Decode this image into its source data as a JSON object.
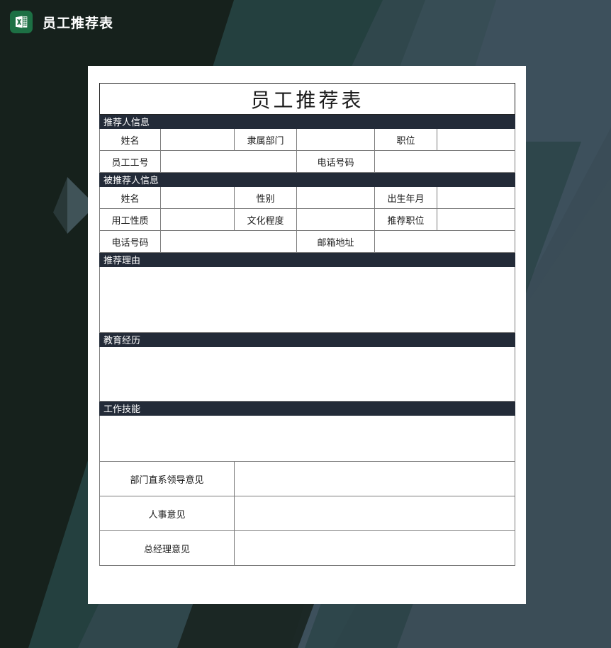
{
  "window": {
    "app_icon": "excel-icon",
    "title": "员工推荐表"
  },
  "document": {
    "title": "员工推荐表",
    "sections": [
      {
        "id": "referrer",
        "band_label": "推荐人信息",
        "rows": [
          {
            "cells": [
              {
                "label": "姓名",
                "value": ""
              },
              {
                "label": "隶属部门",
                "value": ""
              },
              {
                "label": "职位",
                "value": ""
              }
            ]
          },
          {
            "cells": [
              {
                "label": "员工工号",
                "value": ""
              },
              {
                "label": "电话号码",
                "value": ""
              }
            ]
          }
        ]
      },
      {
        "id": "referee",
        "band_label": "被推荐人信息",
        "rows": [
          {
            "cells": [
              {
                "label": "姓名",
                "value": ""
              },
              {
                "label": "性别",
                "value": ""
              },
              {
                "label": "出生年月",
                "value": ""
              }
            ]
          },
          {
            "cells": [
              {
                "label": "用工性质",
                "value": ""
              },
              {
                "label": "文化程度",
                "value": ""
              },
              {
                "label": "推荐职位",
                "value": ""
              }
            ]
          },
          {
            "cells": [
              {
                "label": "电话号码",
                "value": ""
              },
              {
                "label": "邮箱地址",
                "value": ""
              }
            ]
          }
        ]
      }
    ],
    "text_blocks": [
      {
        "id": "reason",
        "band_label": "推荐理由",
        "value": ""
      },
      {
        "id": "education",
        "band_label": "教育经历",
        "value": ""
      },
      {
        "id": "skills",
        "band_label": "工作技能",
        "value": ""
      }
    ],
    "opinions": [
      {
        "id": "dept-leader",
        "label": "部门直系领导意见",
        "value": ""
      },
      {
        "id": "hr",
        "label": "人事意见",
        "value": ""
      },
      {
        "id": "gm",
        "label": "总经理意见",
        "value": ""
      }
    ]
  },
  "colors": {
    "band": "#232b38",
    "paper": "#ffffff",
    "grid": "#7b7b7b",
    "excel_green": "#1d7044",
    "bg_dark_green": "#16211c",
    "bg_teal": "#24403f",
    "bg_slate": "#3b4d57",
    "bg_slate_light": "#465a66"
  }
}
